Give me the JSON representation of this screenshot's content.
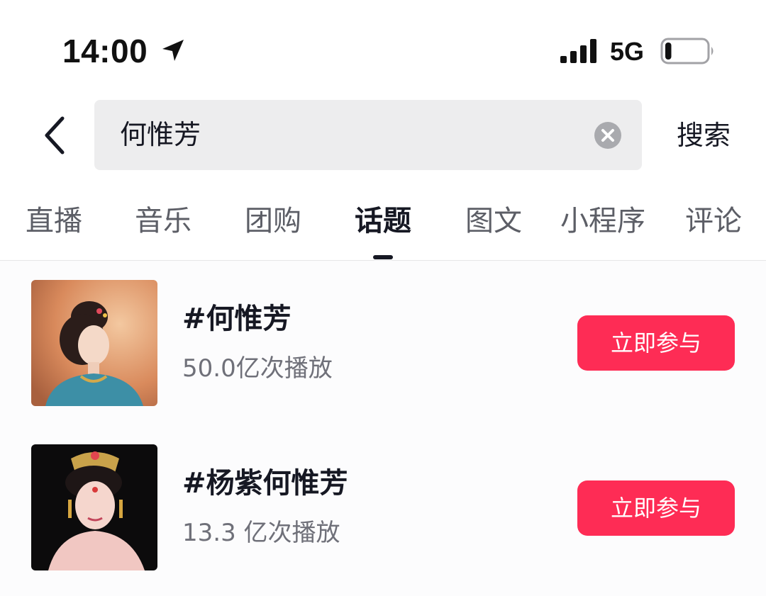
{
  "status_bar": {
    "time": "14:00",
    "network": "5G",
    "icons": [
      "location-arrow-icon",
      "cellular-signal-icon",
      "battery-low-icon"
    ],
    "battery_level": 0.15
  },
  "search": {
    "value": "何惟芳",
    "submit_label": "搜索",
    "icons": [
      "back-chevron-icon",
      "clear-circle-icon"
    ]
  },
  "tabs": [
    {
      "label": "直播",
      "active": false
    },
    {
      "label": "音乐",
      "active": false
    },
    {
      "label": "团购",
      "active": false
    },
    {
      "label": "话题",
      "active": true
    },
    {
      "label": "图文",
      "active": false
    },
    {
      "label": "小程序",
      "active": false
    },
    {
      "label": "评论",
      "active": false
    }
  ],
  "results": [
    {
      "title": "#何惟芳",
      "views": "50.0亿次播放",
      "action_label": "立即参与"
    },
    {
      "title": "#杨紫何惟芳",
      "views": "13.3 亿次播放",
      "action_label": "立即参与"
    }
  ],
  "colors": {
    "accent": "#fe2c55",
    "search_background": "#ededee",
    "text_primary": "#161823",
    "text_secondary": "#6f7079"
  }
}
